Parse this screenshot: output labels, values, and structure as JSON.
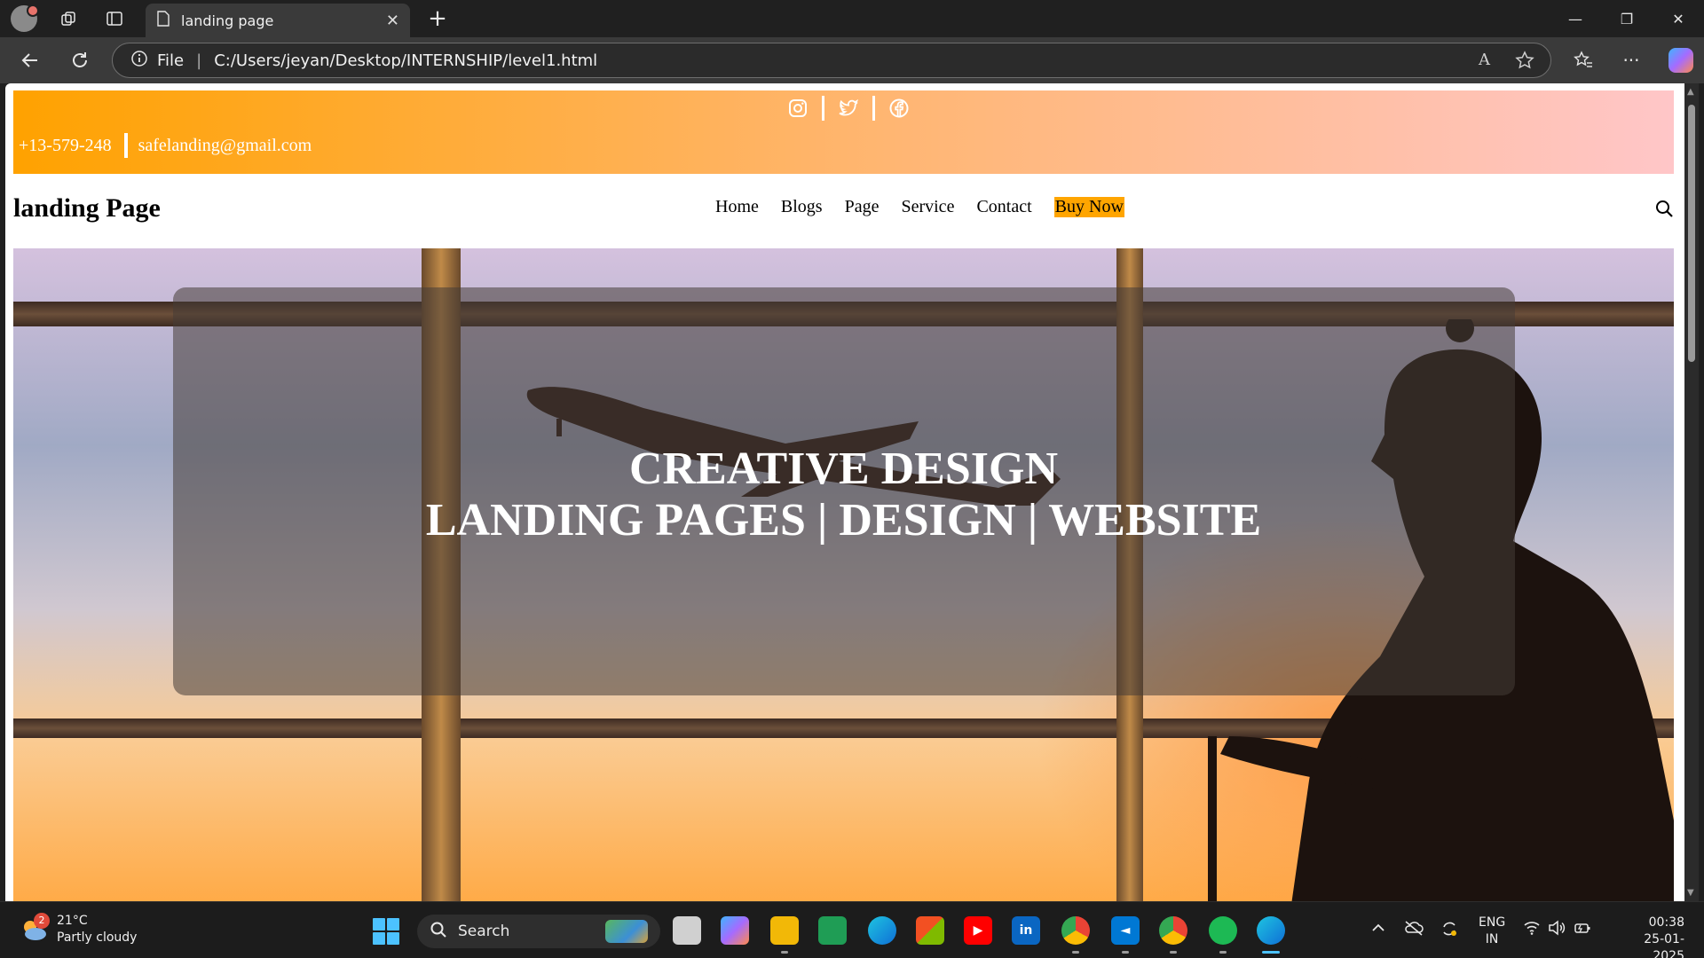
{
  "browser": {
    "tab_title": "landing page",
    "tab_close": "✕",
    "new_tab": "+",
    "address_scheme": "File",
    "address_url": "C:/Users/jeyan/Desktop/INTERNSHIP/level1.html",
    "minimize": "—",
    "maximize": "❐",
    "close": "✕",
    "read_aloud": "A",
    "more": "···"
  },
  "page": {
    "topbar": {
      "phone": "+13-579-248",
      "email": "safelanding@gmail.com",
      "social_icons": [
        "instagram-icon",
        "twitter-icon",
        "facebook-icon"
      ]
    },
    "navbar": {
      "brand": "landing Page",
      "menu": [
        "Home",
        "Blogs",
        "Page",
        "Service",
        "Contact",
        "Buy Now"
      ]
    },
    "hero": {
      "line1": "CREATIVE DESIGN",
      "line2": "LANDING PAGES | DESIGN | WEBSITE"
    },
    "colors": {
      "topbar_start": "#ffa200",
      "topbar_end": "#ffc6c8",
      "buy_now_bg": "#ffa500"
    }
  },
  "taskbar": {
    "weather_temp": "21°C",
    "weather_desc": "Partly cloudy",
    "weather_badge": "2",
    "search_label": "Search",
    "lang_line1": "ENG",
    "lang_line2": "IN",
    "time": "00:38",
    "date": "25-01-2025"
  }
}
